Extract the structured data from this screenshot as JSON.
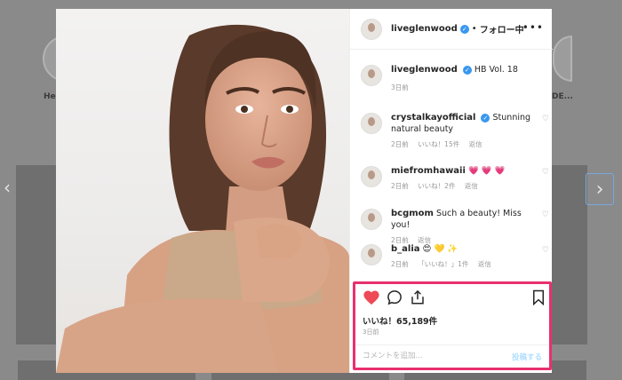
{
  "background": {
    "highlights": [
      {
        "label": "He"
      },
      {
        "label": "DE..."
      }
    ],
    "prev_arrow": "‹",
    "next_arrow": "›"
  },
  "header": {
    "username": "liveglenwood",
    "verified": "✓",
    "separator": "•",
    "follow_status": "フォロー中",
    "more": "•••"
  },
  "caption": {
    "username": "liveglenwood",
    "text": "HB Vol. 18",
    "time": "3日前"
  },
  "comments": [
    {
      "username": "crystalkayofficial",
      "verified": true,
      "text": "Stunning natural beauty",
      "time": "2日前",
      "likes": "いいね！15件",
      "reply": "返信"
    },
    {
      "username": "miefromhawaii",
      "verified": false,
      "text": "💗 💗 💗",
      "time": "2日前",
      "likes": "いいね！2件",
      "reply": "返信"
    },
    {
      "username": "bcgmom",
      "verified": false,
      "text": "Such a beauty! Miss you!",
      "time": "2日前",
      "likes": "",
      "reply": "返信"
    },
    {
      "username": "b_alia",
      "verified": false,
      "text": "😍 💛 ✨",
      "time": "2日前",
      "likes": "「いいね！」1件",
      "reply": "返信"
    }
  ],
  "actions": {
    "likes_text": "いいね！65,189件",
    "date": "3日前",
    "comment_placeholder": "コメントを追加...",
    "post_label": "投稿する"
  },
  "colors": {
    "like_red": "#ed4956",
    "highlight_border": "#e8306f",
    "verified_blue": "#3897f0"
  }
}
